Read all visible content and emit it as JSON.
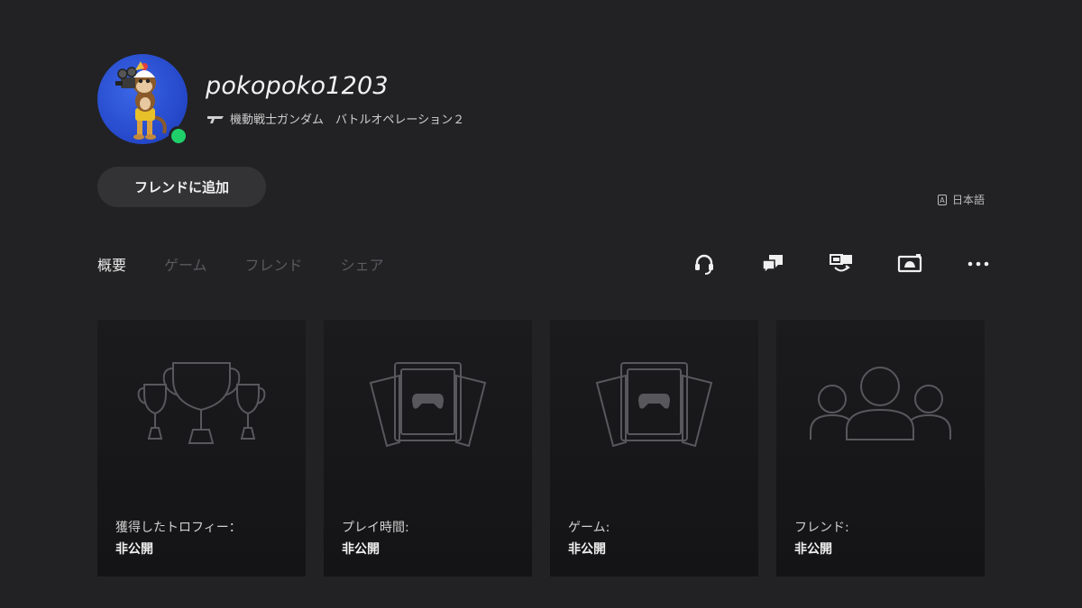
{
  "profile": {
    "username": "pokopoko1203",
    "now_playing": "機動戦士ガンダム　バトルオペレーション２",
    "status_color": "#1fcf6a"
  },
  "add_friend_label": "フレンドに追加",
  "language_label": "日本語",
  "tabs": [
    {
      "label": "概要",
      "active": true
    },
    {
      "label": "ゲーム",
      "active": false
    },
    {
      "label": "フレンド",
      "active": false
    },
    {
      "label": "シェア",
      "active": false
    }
  ],
  "action_icons": [
    "headset-icon",
    "message-icon",
    "share-screen-icon",
    "share-play-icon",
    "more-icon"
  ],
  "cards": [
    {
      "label": "獲得したトロフィー：",
      "value": "非公開",
      "icon": "trophy-icon"
    },
    {
      "label": "プレイ時間:",
      "value": "非公開",
      "icon": "game-cards-icon"
    },
    {
      "label": "ゲーム:",
      "value": "非公開",
      "icon": "game-cards-icon"
    },
    {
      "label": "フレンド:",
      "value": "非公開",
      "icon": "friends-icon"
    }
  ],
  "colors": {
    "background": "#222224",
    "card": "#1a1a1c",
    "button": "#333336",
    "inactive_tab": "#5a5a5e",
    "icon_stroke": "#58585c"
  }
}
